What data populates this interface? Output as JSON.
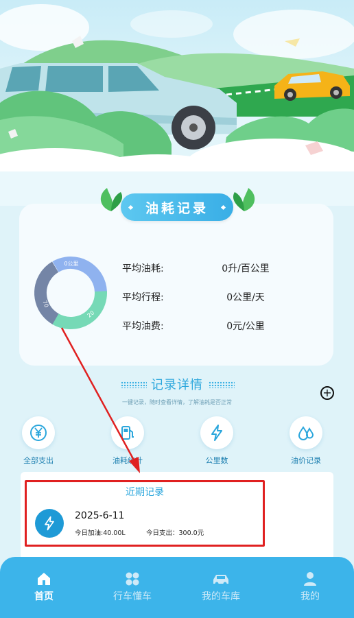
{
  "fuel_record": {
    "title": "油耗记录",
    "donut_labels": [
      "0公里",
      "20",
      "70"
    ],
    "stats": [
      {
        "label": "平均油耗:",
        "value": "0升/百公里"
      },
      {
        "label": "平均行程:",
        "value": "0公里/天"
      },
      {
        "label": "平均油费:",
        "value": "0元/公里"
      }
    ]
  },
  "detail": {
    "title": "记录详情",
    "subtitle": "一键记录，随时查看详情，了解油耗是否正常"
  },
  "shortcuts": [
    {
      "label": "全部支出",
      "icon": "yuan-icon"
    },
    {
      "label": "油耗统计",
      "icon": "fuel-pump-icon"
    },
    {
      "label": "公里数",
      "icon": "lightning-icon"
    },
    {
      "label": "油价记录",
      "icon": "droplets-icon"
    }
  ],
  "recent": {
    "title": "近期记录",
    "date": "2025-6-11",
    "fuel": "今日加油:40.00L",
    "cost": "今日支出：300.0元"
  },
  "tabs": [
    {
      "label": "首页",
      "icon": "home-icon",
      "active": true
    },
    {
      "label": "行车懂车",
      "icon": "grid-icon",
      "active": false
    },
    {
      "label": "我的车库",
      "icon": "car-icon",
      "active": false
    },
    {
      "label": "我的",
      "icon": "user-icon",
      "active": false
    }
  ],
  "colors": {
    "accent": "#2aa6dc",
    "tabbar": "#3cb4ea",
    "highlight": "#e02020",
    "donut": [
      "#8fb2ef",
      "#76d9b6",
      "#7485a6"
    ]
  }
}
